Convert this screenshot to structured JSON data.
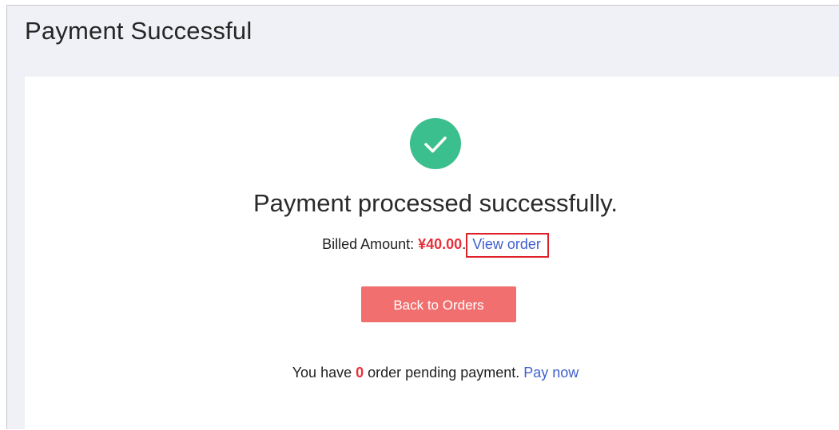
{
  "header": {
    "title": "Payment Successful"
  },
  "result": {
    "icon": "check-circle-icon",
    "icon_color": "#3cbf8e",
    "headline": "Payment processed successfully.",
    "billed_label": "Billed Amount: ",
    "billed_amount": "¥40.00",
    "billed_suffix": ".",
    "view_order_link": "View order",
    "amount_color": "#e8303a",
    "link_color": "#3f5fcf"
  },
  "actions": {
    "back_button_label": "Back to Orders",
    "back_button_color": "#f26f6f"
  },
  "pending": {
    "prefix": "You have ",
    "count": "0",
    "suffix": " order pending payment. ",
    "pay_now_link": "Pay now"
  }
}
